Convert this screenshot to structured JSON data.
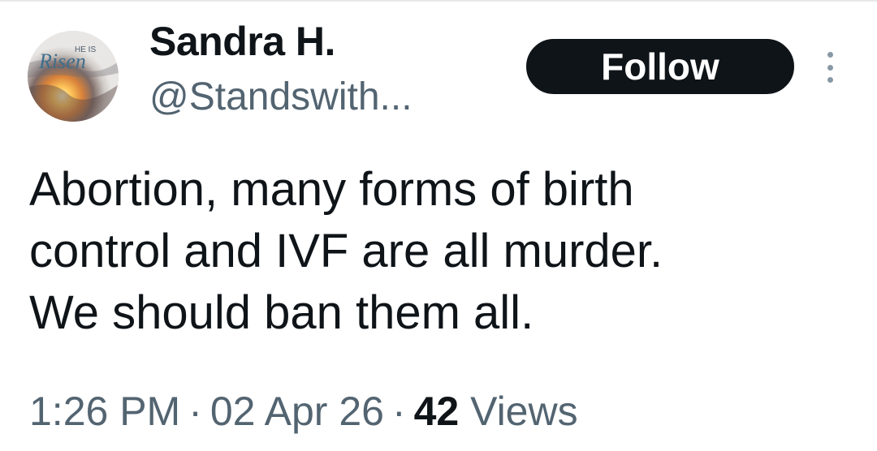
{
  "tweet": {
    "author": {
      "name": "Sandra H.",
      "handle": "@Standswith...",
      "avatar_text_small": "HE IS",
      "avatar_text_large": "Risen"
    },
    "follow_label": "Follow",
    "more_icon": "more-vertical-icon",
    "text_lines": [
      "Abortion, many forms of birth",
      "control and IVF are all murder.",
      "We should ban them all."
    ],
    "meta": {
      "time": "1:26 PM",
      "separator": "·",
      "date": "02 Apr 26",
      "views_count": "42",
      "views_label": "Views"
    }
  },
  "colors": {
    "text_primary": "#0f1419",
    "text_secondary": "#536471",
    "button_bg": "#0f1419",
    "button_text": "#ffffff"
  }
}
